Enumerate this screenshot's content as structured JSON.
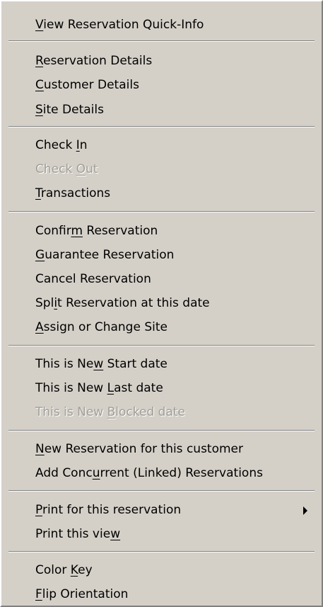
{
  "menu": {
    "items": [
      {
        "pre": "",
        "key": "V",
        "post": "iew Reservation Quick-Info",
        "disabled": false
      },
      {
        "pre": "",
        "key": "R",
        "post": "eservation Details",
        "disabled": false
      },
      {
        "pre": "",
        "key": "C",
        "post": "ustomer Details",
        "disabled": false
      },
      {
        "pre": "",
        "key": "S",
        "post": "ite Details",
        "disabled": false
      },
      {
        "pre": "Check ",
        "key": "I",
        "post": "n",
        "disabled": false
      },
      {
        "pre": "Check ",
        "key": "O",
        "post": "ut",
        "disabled": true
      },
      {
        "pre": "",
        "key": "T",
        "post": "ransactions",
        "disabled": false
      },
      {
        "pre": "Confir",
        "key": "m",
        "post": " Reservation",
        "disabled": false
      },
      {
        "pre": "",
        "key": "G",
        "post": "uarantee Reservation",
        "disabled": false
      },
      {
        "pre": "Cancel Reservation",
        "key": "",
        "post": "",
        "disabled": false
      },
      {
        "pre": "Spl",
        "key": "i",
        "post": "t Reservation at this date",
        "disabled": false
      },
      {
        "pre": "",
        "key": "A",
        "post": "ssign or Change Site",
        "disabled": false
      },
      {
        "pre": "This is Ne",
        "key": "w",
        "post": " Start date",
        "disabled": false
      },
      {
        "pre": "This is New ",
        "key": "L",
        "post": "ast date",
        "disabled": false
      },
      {
        "pre": "This is New ",
        "key": "B",
        "post": "locked date",
        "disabled": true
      },
      {
        "pre": "",
        "key": "N",
        "post": "ew Reservation for this customer",
        "disabled": false
      },
      {
        "pre": "Add Conc",
        "key": "u",
        "post": "rrent (Linked) Reservations",
        "disabled": false
      },
      {
        "pre": "",
        "key": "P",
        "post": "rint for this reservation",
        "disabled": false,
        "submenu": true
      },
      {
        "pre": "Print this vie",
        "key": "w",
        "post": "",
        "disabled": false
      },
      {
        "pre": "Color ",
        "key": "K",
        "post": "ey",
        "disabled": false
      },
      {
        "pre": "",
        "key": "F",
        "post": "lip Orientation",
        "disabled": false
      }
    ]
  }
}
